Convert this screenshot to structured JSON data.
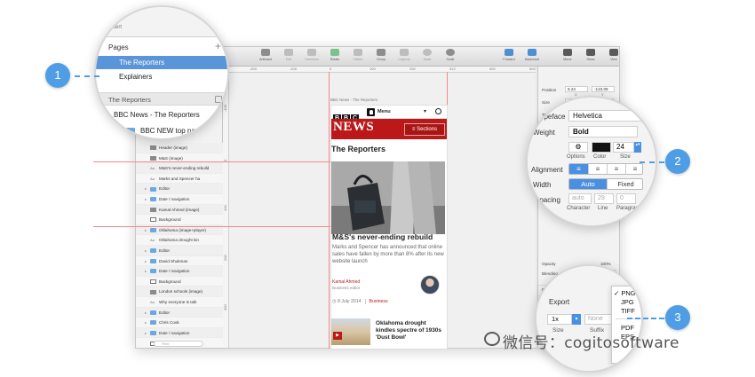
{
  "lens1": {
    "menu_clip": "Insert",
    "pages_header": "Pages",
    "add_icon": "plus-icon",
    "pages": [
      {
        "label": "The Reporters",
        "selected": true
      },
      {
        "label": "Explainers",
        "selected": false
      }
    ],
    "current_page_label": "The Reporters",
    "tree": [
      {
        "label": "BBC News - The Reporters"
      },
      {
        "label": "BBC NEW top nav"
      }
    ]
  },
  "sidebar": {
    "layers": [
      {
        "label": "Header (image)",
        "icon": "img",
        "arrow": false
      },
      {
        "label": "M&S (image)",
        "icon": "img",
        "arrow": false
      },
      {
        "label": "M&S's never-ending rebuild",
        "icon": "text",
        "arrow": false
      },
      {
        "label": "Marks and Spencer ha",
        "icon": "text",
        "arrow": false
      },
      {
        "label": "Editor",
        "icon": "folder",
        "arrow": true
      },
      {
        "label": "Date / navigation",
        "icon": "folder",
        "arrow": true
      },
      {
        "label": "Kamal Ahmed (image)",
        "icon": "img",
        "arrow": false
      },
      {
        "label": "Background",
        "icon": "rect",
        "arrow": false
      },
      {
        "label": "Oklahoma (image+player)",
        "icon": "folder",
        "arrow": true
      },
      {
        "label": "Oklahoma drought kin",
        "icon": "text",
        "arrow": false
      },
      {
        "label": "Editor",
        "icon": "folder",
        "arrow": true
      },
      {
        "label": "David Shukman",
        "icon": "folder",
        "arrow": true
      },
      {
        "label": "Date / navigation",
        "icon": "folder",
        "arrow": true
      },
      {
        "label": "Background",
        "icon": "rect",
        "arrow": false
      },
      {
        "label": "London schools (image)",
        "icon": "img",
        "arrow": false
      },
      {
        "label": "Why everyone is talk",
        "icon": "text",
        "arrow": false
      },
      {
        "label": "Editor",
        "icon": "folder",
        "arrow": true
      },
      {
        "label": "Chris Cook",
        "icon": "folder",
        "arrow": true
      },
      {
        "label": "Date / navigation",
        "icon": "folder",
        "arrow": true
      },
      {
        "label": "Background",
        "icon": "rect",
        "arrow": false
      }
    ],
    "filter_placeholder": "Filter"
  },
  "toolbar": {
    "items": [
      {
        "label": "Artboard",
        "icon": "artboard-icon",
        "dim": false
      },
      {
        "label": "Edit",
        "icon": "edit-icon",
        "dim": true
      },
      {
        "label": "Transform",
        "icon": "transform-icon",
        "dim": true
      },
      {
        "label": "Rotate",
        "icon": "rotate-icon",
        "dim": false
      },
      {
        "label": "Flatten",
        "icon": "flatten-icon",
        "dim": true
      },
      {
        "label": "Group",
        "icon": "group-icon",
        "dim": false
      },
      {
        "label": "Ungroup",
        "icon": "ungroup-icon",
        "dim": true
      },
      {
        "label": "Mask",
        "icon": "mask-icon",
        "dim": true
      },
      {
        "label": "Scale",
        "icon": "scale-icon",
        "dim": false
      },
      {
        "label": "Forward",
        "icon": "forward-icon",
        "dim": false
      },
      {
        "label": "Backward",
        "icon": "backward-icon",
        "dim": false
      },
      {
        "label": "Mirror",
        "icon": "mirror-icon",
        "dim": false
      },
      {
        "label": "Show",
        "icon": "show-icon",
        "dim": false
      },
      {
        "label": "View",
        "icon": "view-icon",
        "dim": false
      },
      {
        "label": "Export",
        "icon": "export-icon",
        "dim": false
      }
    ]
  },
  "ruler": {
    "h_ticks": [
      "-200",
      "-100",
      "0",
      "100",
      "200",
      "312",
      "400",
      "500"
    ],
    "v_ticks": [
      "-100",
      "0",
      "100",
      "200",
      "300",
      "400"
    ]
  },
  "inspector": {
    "position_label": "Position",
    "position_x": "8.24",
    "position_y": "-123.09",
    "x_label": "X",
    "y_label": "Y",
    "size_label": "Size",
    "size_w": "163",
    "size_h": "29",
    "transform_label": "Transform",
    "opacity_label": "Opacity",
    "opacity_value": "100%",
    "blending_label": "Blending",
    "blending_value": "Normal",
    "sections": [
      "Fills",
      "Borders",
      "Shadows",
      "Inner Shadows",
      "Gaussian"
    ]
  },
  "lens2": {
    "typeface_label": "Typeface",
    "typeface_value": "Helvetica",
    "weight_label": "Weight",
    "weight_value": "Bold",
    "options_label": "Options",
    "color_label": "Color",
    "size_label": "Size",
    "size_value": "24",
    "alignment_label": "Alignment",
    "width_label": "Width",
    "width_options": [
      {
        "label": "Auto",
        "active": true
      },
      {
        "label": "Fixed",
        "active": false
      }
    ],
    "spacing_label": "Spacing",
    "spacing_values": [
      "auto",
      "29",
      "0"
    ],
    "spacing_sublabels": [
      "Character",
      "Line",
      "Paragraph"
    ],
    "text_color": "#111111",
    "accent": "#4a90e2"
  },
  "lens3": {
    "export_label": "Export",
    "scale_value": "1x",
    "prefix_placeholder": "None",
    "size_label": "Size",
    "suffix_label": "Suffix",
    "formats": [
      {
        "label": "PNG",
        "checked": true
      },
      {
        "label": "JPG",
        "checked": false
      },
      {
        "label": "TIFF",
        "checked": false
      },
      {
        "label": "PDF",
        "checked": false
      },
      {
        "label": "EPS",
        "checked": false
      }
    ]
  },
  "artboard": {
    "label": "BBC News - The Reporters",
    "bbc_letters": [
      "B",
      "B",
      "C"
    ],
    "menu_label": "Menu",
    "news_logo": "NEWS",
    "sections_label": "Sections",
    "page_title": "The Reporters",
    "headline": "M&S's never-ending rebuild",
    "summary": "Marks and Spencer has announced that online sales have fallen by more than 8% after its new website launch",
    "author": "Kamal Ahmed",
    "author_role": "Business editor",
    "date": "8 July 2014",
    "category": "Business",
    "second_headline": "Oklahoma drought kindles spectre of 1930s 'Dust Bowl'",
    "brand_color": "#bb1919"
  },
  "callouts": [
    "1",
    "2",
    "3"
  ],
  "watermark": "微信号：cogitosoftware"
}
